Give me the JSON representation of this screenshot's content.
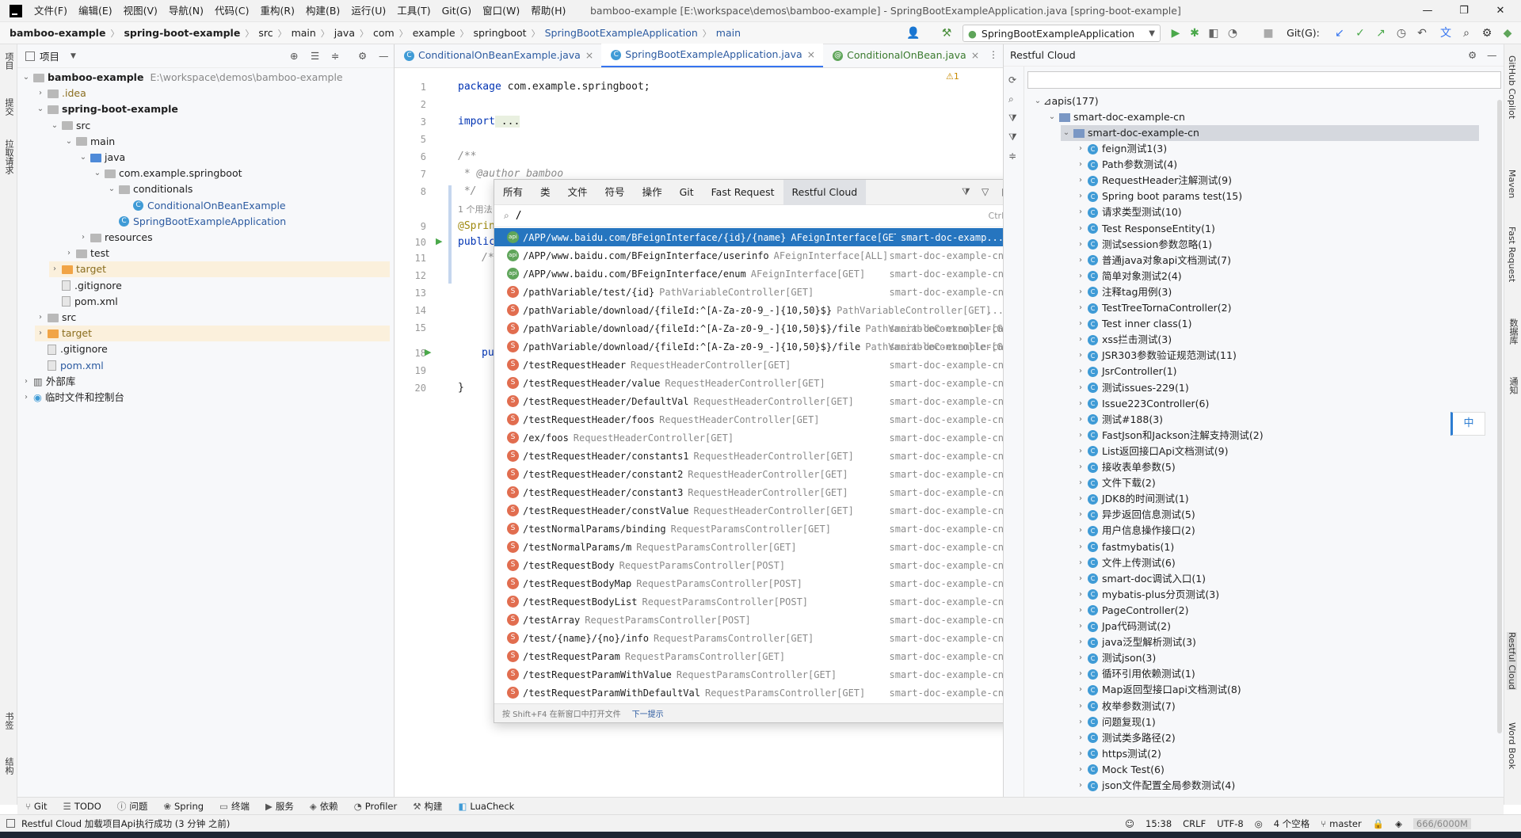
{
  "titlebar": {
    "menus": [
      "文件(F)",
      "编辑(E)",
      "视图(V)",
      "导航(N)",
      "代码(C)",
      "重构(R)",
      "构建(B)",
      "运行(U)",
      "工具(T)",
      "Git(G)",
      "窗口(W)",
      "帮助(H)"
    ],
    "window_title": "bamboo-example [E:\\workspace\\demos\\bamboo-example] - SpringBootExampleApplication.java [spring-boot-example]"
  },
  "navbar": {
    "crumbs": [
      "bamboo-example",
      "spring-boot-example",
      "src",
      "main",
      "java",
      "com",
      "example",
      "springboot",
      "SpringBootExampleApplication",
      "main"
    ],
    "run_config": "SpringBootExampleApplication",
    "git_label": "Git(G):"
  },
  "left_stripe": {
    "tabs": [
      "项目",
      "提交",
      "拉取请求",
      "书签",
      "结构"
    ]
  },
  "project": {
    "header": "项目",
    "tree": [
      {
        "label": "bamboo-example",
        "path": "E:\\workspace\\demos\\bamboo-example",
        "depth": 0,
        "open": true,
        "icon": "folder-gray",
        "bold": true
      },
      {
        "label": ".idea",
        "depth": 1,
        "open": false,
        "icon": "folder-gray",
        "color": "#8a6d1e"
      },
      {
        "label": "spring-boot-example",
        "depth": 1,
        "open": true,
        "icon": "folder-gray",
        "bold": true
      },
      {
        "label": "src",
        "depth": 2,
        "open": true,
        "icon": "folder-gray"
      },
      {
        "label": "main",
        "depth": 3,
        "open": true,
        "icon": "folder-gray"
      },
      {
        "label": "java",
        "depth": 4,
        "open": true,
        "icon": "folder-src"
      },
      {
        "label": "com.example.springboot",
        "depth": 5,
        "open": true,
        "icon": "folder-gray"
      },
      {
        "label": "conditionals",
        "depth": 6,
        "open": true,
        "icon": "folder-gray"
      },
      {
        "label": "ConditionalOnBeanExample",
        "depth": 7,
        "icon": "class",
        "color": "#2b5aa0"
      },
      {
        "label": "SpringBootExampleApplication",
        "depth": 6,
        "icon": "class",
        "color": "#2b5aa0"
      },
      {
        "label": "resources",
        "depth": 4,
        "open": false,
        "icon": "folder-gray"
      },
      {
        "label": "test",
        "depth": 3,
        "open": false,
        "icon": "folder-gray"
      },
      {
        "label": "target",
        "depth": 2,
        "open": false,
        "icon": "folder-orange",
        "color": "#8a6d1e",
        "hl": true
      },
      {
        "label": ".gitignore",
        "depth": 2,
        "icon": "file"
      },
      {
        "label": "pom.xml",
        "depth": 2,
        "icon": "file",
        "color": "#1e1e1e"
      },
      {
        "label": "src",
        "depth": 1,
        "open": false,
        "icon": "folder-gray"
      },
      {
        "label": "target",
        "depth": 1,
        "open": false,
        "icon": "folder-orange",
        "color": "#8a6d1e",
        "hl": true
      },
      {
        "label": ".gitignore",
        "depth": 1,
        "icon": "file"
      },
      {
        "label": "pom.xml",
        "depth": 1,
        "icon": "file",
        "color": "#2b5aa0"
      },
      {
        "label": "外部库",
        "depth": 0,
        "open": false,
        "icon": "lib"
      },
      {
        "label": "临时文件和控制台",
        "depth": 0,
        "open": false,
        "icon": "scratch"
      }
    ]
  },
  "editor": {
    "tabs": [
      {
        "label": "ConditionalOnBeanExample.java",
        "active": false
      },
      {
        "label": "SpringBootExampleApplication.java",
        "active": true
      },
      {
        "label": "ConditionalOnBean.java",
        "active": false
      }
    ],
    "warning_count": "1",
    "line_numbers": [
      "1",
      "2",
      "3",
      "5",
      "6",
      "7",
      "8",
      "",
      "9",
      "10",
      "11",
      "12",
      "13",
      "14",
      "15",
      "18",
      "19",
      "20"
    ],
    "code": {
      "package_kw": "package",
      "package_name": " com.example.springboot;",
      "import_kw": "import",
      "import_rest": " ...",
      "doc_open": "/**",
      "author_line": " * @author bamboo",
      "doc_close": " */",
      "usage_hint": "1 个用法",
      "annotation": "@Sprin",
      "public_kw": "public",
      "close_brace": "}",
      "fold1": "/*",
      "pu": "pu"
    }
  },
  "popup": {
    "tabs": [
      "所有",
      "类",
      "文件",
      "符号",
      "操作",
      "Git",
      "Fast Request",
      "Restful Cloud"
    ],
    "search_value": "/",
    "shortcut": "Ctrl+Q",
    "results": [
      {
        "mark": "G",
        "path": "/APP/www.baidu.com/BFeignInterface/{id}/{name}",
        "meta": "AFeignInterface[GET]",
        "proj": "smart-doc-examp...",
        "sel": true
      },
      {
        "mark": "G",
        "path": "/APP/www.baidu.com/BFeignInterface/userinfo",
        "meta": "AFeignInterface[ALL]",
        "proj": "smart-doc-example-cn"
      },
      {
        "mark": "G",
        "path": "/APP/www.baidu.com/BFeignInterface/enum",
        "meta": "AFeignInterface[GET]",
        "proj": "smart-doc-example-cn"
      },
      {
        "mark": "S",
        "path": "/pathVariable/test/{id}",
        "meta": "PathVariableController[GET]",
        "proj": "smart-doc-example-cn"
      },
      {
        "mark": "S",
        "path": "/pathVariable/download/{fileId:^[A-Za-z0-9_-]{10,50}$}",
        "meta": "PathVariableController[GET]",
        "proj": "..."
      },
      {
        "mark": "S",
        "path": "/pathVariable/download/{fileId:^[A-Za-z0-9_-]{10,50}$}/file",
        "meta": "PathVariableController[GET]",
        "proj": "smart-doc-example-cn"
      },
      {
        "mark": "S",
        "path": "/pathVariable/download/{fileId:^[A-Za-z0-9_-]{10,50}$}/file",
        "meta": "PathVariableController[GET]",
        "proj": "smart-doc-example-cn"
      },
      {
        "mark": "S",
        "path": "/testRequestHeader",
        "meta": "RequestHeaderController[GET]",
        "proj": "smart-doc-example-cn"
      },
      {
        "mark": "S",
        "path": "/testRequestHeader/value",
        "meta": "RequestHeaderController[GET]",
        "proj": "smart-doc-example-cn"
      },
      {
        "mark": "S",
        "path": "/testRequestHeader/DefaultVal",
        "meta": "RequestHeaderController[GET]",
        "proj": "smart-doc-example-cn"
      },
      {
        "mark": "S",
        "path": "/testRequestHeader/foos",
        "meta": "RequestHeaderController[GET]",
        "proj": "smart-doc-example-cn"
      },
      {
        "mark": "S",
        "path": "/ex/foos",
        "meta": "RequestHeaderController[GET]",
        "proj": "smart-doc-example-cn"
      },
      {
        "mark": "S",
        "path": "/testRequestHeader/constants1",
        "meta": "RequestHeaderController[GET]",
        "proj": "smart-doc-example-cn"
      },
      {
        "mark": "S",
        "path": "/testRequestHeader/constant2",
        "meta": "RequestHeaderController[GET]",
        "proj": "smart-doc-example-cn"
      },
      {
        "mark": "S",
        "path": "/testRequestHeader/constant3",
        "meta": "RequestHeaderController[GET]",
        "proj": "smart-doc-example-cn"
      },
      {
        "mark": "S",
        "path": "/testRequestHeader/constValue",
        "meta": "RequestHeaderController[GET]",
        "proj": "smart-doc-example-cn"
      },
      {
        "mark": "S",
        "path": "/testNormalParams/binding",
        "meta": "RequestParamsController[GET]",
        "proj": "smart-doc-example-cn"
      },
      {
        "mark": "S",
        "path": "/testNormalParams/m",
        "meta": "RequestParamsController[GET]",
        "proj": "smart-doc-example-cn"
      },
      {
        "mark": "S",
        "path": "/testRequestBody",
        "meta": "RequestParamsController[POST]",
        "proj": "smart-doc-example-cn"
      },
      {
        "mark": "S",
        "path": "/testRequestBodyMap",
        "meta": "RequestParamsController[POST]",
        "proj": "smart-doc-example-cn"
      },
      {
        "mark": "S",
        "path": "/testRequestBodyList",
        "meta": "RequestParamsController[POST]",
        "proj": "smart-doc-example-cn"
      },
      {
        "mark": "S",
        "path": "/testArray",
        "meta": "RequestParamsController[POST]",
        "proj": "smart-doc-example-cn"
      },
      {
        "mark": "S",
        "path": "/test/{name}/{no}/info",
        "meta": "RequestParamsController[GET]",
        "proj": "smart-doc-example-cn"
      },
      {
        "mark": "S",
        "path": "/testRequestParam",
        "meta": "RequestParamsController[GET]",
        "proj": "smart-doc-example-cn"
      },
      {
        "mark": "S",
        "path": "/testRequestParamWithValue",
        "meta": "RequestParamsController[GET]",
        "proj": "smart-doc-example-cn"
      },
      {
        "mark": "S",
        "path": "/testRequestParamWithDefaultVal",
        "meta": "RequestParamsController[GET]",
        "proj": "smart-doc-example-cn"
      }
    ],
    "footer_hint": "按 Shift+F4 在新窗口中打开文件",
    "footer_link": "下一提示"
  },
  "restful": {
    "title": "Restful Cloud",
    "root": "apis(177)",
    "project": "smart-doc-example-cn",
    "module": "smart-doc-example-cn",
    "items": [
      "feign测试1(3)",
      "Path参数测试(4)",
      "RequestHeader注解测试(9)",
      "Spring boot params test(15)",
      "请求类型测试(10)",
      "Test ResponseEntity(1)",
      "测试session参数忽略(1)",
      "普通java对象api文档测试(7)",
      "简单对象测试2(4)",
      "注释tag用例(3)",
      "TestTreeTornaController(2)",
      "Test inner class(1)",
      "xss拦击测试(3)",
      "JSR303参数验证规范测试(11)",
      "JsrController(1)",
      "测试issues-229(1)",
      "Issue223Controller(6)",
      "测试#188(3)",
      "FastJson和Jackson注解支持测试(2)",
      "List返回接口Api文档测试(9)",
      "接收表单参数(5)",
      "文件下载(2)",
      "JDK8的时间测试(1)",
      "异步返回信息测试(5)",
      "用户信息操作接口(2)",
      "fastmybatis(1)",
      "文件上传测试(6)",
      "smart-doc调试入口(1)",
      "mybatis-plus分页测试(3)",
      "PageController(2)",
      "Jpa代码测试(2)",
      "java泛型解析测试(3)",
      "测试json(3)",
      "循环引用依赖测试(1)",
      "Map返回型接口api文档测试(8)",
      "枚举参数测试(7)",
      "问题复现(1)",
      "测试类多路径(2)",
      "https测试(2)",
      "Mock Test(6)",
      "json文件配置全局参数测试(4)"
    ]
  },
  "right_stripe": {
    "tabs": [
      "GitHub Copilot",
      "Maven",
      "Fast Request",
      "数据库",
      "通知",
      "Restful Cloud",
      "Word Book"
    ]
  },
  "ime": "中",
  "bottom_tools": [
    "Git",
    "TODO",
    "问题",
    "Spring",
    "终端",
    "服务",
    "依赖",
    "Profiler",
    "构建",
    "LuaCheck"
  ],
  "status": {
    "message": "Restful Cloud 加载项目Api执行成功 (3 分钟 之前)",
    "position": "15:38",
    "line_sep": "CRLF",
    "encoding": "UTF-8",
    "indent": "4 个空格",
    "branch": "master",
    "memory": "666/6000M"
  }
}
